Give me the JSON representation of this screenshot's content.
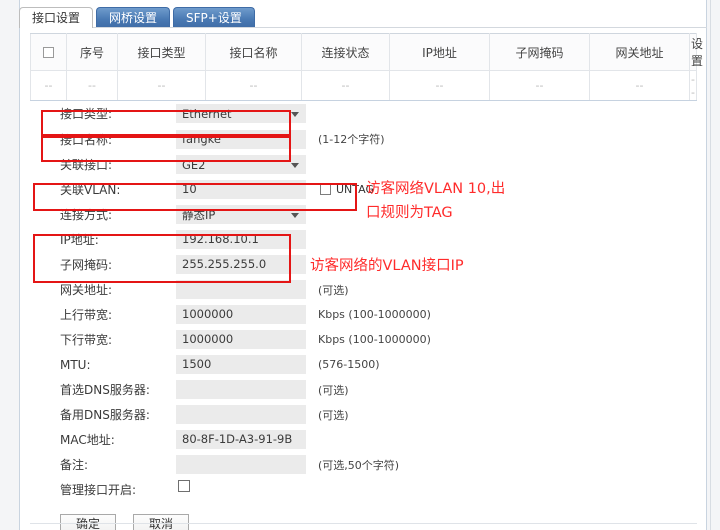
{
  "tabs": [
    {
      "label": "接口设置",
      "active": true
    },
    {
      "label": "网桥设置",
      "active": false
    },
    {
      "label": "SFP+设置",
      "active": false
    }
  ],
  "table": {
    "headers": [
      "",
      "序号",
      "接口类型",
      "接口名称",
      "连接状态",
      "IP地址",
      "子网掩码",
      "网关地址",
      "设置"
    ],
    "rows": [
      [
        "--",
        "--",
        "--",
        "--",
        "--",
        "--",
        "--",
        "--",
        "--"
      ]
    ]
  },
  "form": {
    "interface_type": {
      "label": "接口类型:",
      "value": "Ethernet",
      "control": "select"
    },
    "interface_name": {
      "label": "接口名称:",
      "value": "fangke",
      "control": "input",
      "hint": "(1-12个字符)"
    },
    "bind_port": {
      "label": "关联接口:",
      "value": "GE2",
      "control": "select"
    },
    "bind_vlan": {
      "label": "关联VLAN:",
      "value": "10",
      "control": "input",
      "untag_label": "UNTAG",
      "untag_checked": false
    },
    "connect_mode": {
      "label": "连接方式:",
      "value": "静态IP",
      "control": "select"
    },
    "ip_address": {
      "label": "IP地址:",
      "value": "192.168.10.1",
      "control": "input"
    },
    "subnet_mask": {
      "label": "子网掩码:",
      "value": "255.255.255.0",
      "control": "input"
    },
    "gateway": {
      "label": "网关地址:",
      "value": "",
      "control": "input",
      "hint": "(可选)"
    },
    "upstream_bw": {
      "label": "上行带宽:",
      "value": "1000000",
      "control": "input",
      "hint": "Kbps (100-1000000)"
    },
    "downstream_bw": {
      "label": "下行带宽:",
      "value": "1000000",
      "control": "input",
      "hint": "Kbps (100-1000000)"
    },
    "mtu": {
      "label": "MTU:",
      "value": "1500",
      "control": "input",
      "hint": "(576-1500)"
    },
    "dns_primary": {
      "label": "首选DNS服务器:",
      "value": "",
      "control": "input",
      "hint": "(可选)"
    },
    "dns_backup": {
      "label": "备用DNS服务器:",
      "value": "",
      "control": "input",
      "hint": "(可选)"
    },
    "mac_address": {
      "label": "MAC地址:",
      "value": "80-8F-1D-A3-91-9B",
      "control": "input"
    },
    "remark": {
      "label": "备注:",
      "value": "",
      "control": "input",
      "hint": "(可选,50个字符)"
    },
    "mgmt_enable": {
      "label": "管理接口开启:",
      "checked": false
    }
  },
  "buttons": {
    "confirm": "确定",
    "cancel": "取消"
  },
  "annotations": {
    "vlan_note_line1": "访客网络VLAN 10,出",
    "vlan_note_line2": "口规则为TAG",
    "ip_note": "访客网络的VLAN接口IP",
    "color": "#ff2b2b"
  }
}
